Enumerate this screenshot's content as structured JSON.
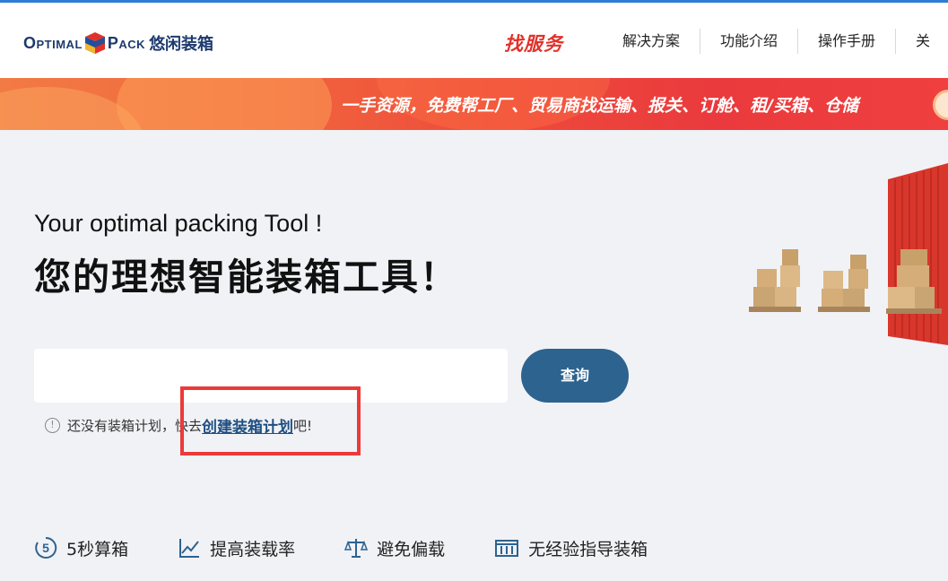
{
  "header": {
    "logo": {
      "text_left": "Optimal",
      "text_right": "Pack",
      "text_cn": "悠闲装箱"
    },
    "service_label": "找服务",
    "nav": [
      "解决方案",
      "功能介绍",
      "操作手册",
      "关"
    ]
  },
  "banner": {
    "text": "一手资源，免费帮工厂、贸易商找运输、报关、订舱、租/买箱、仓储"
  },
  "hero": {
    "title_en": "Your optimal packing Tool !",
    "title_cn": "您的理想智能装箱工具！"
  },
  "search": {
    "value": "",
    "placeholder": "",
    "button_label": "查询"
  },
  "hint": {
    "icon": "!",
    "prefix": "还没有装箱计划，快去",
    "link": "创建装箱计划",
    "suffix": "吧!"
  },
  "features": [
    {
      "icon": "five-seconds-icon",
      "label": "5秒算箱"
    },
    {
      "icon": "chart-line-icon",
      "label": "提高装载率"
    },
    {
      "icon": "balance-scale-icon",
      "label": "避免偏载"
    },
    {
      "icon": "container-guide-icon",
      "label": "无经验指导装箱"
    }
  ],
  "colors": {
    "accent": "#2d638f",
    "brand_red": "#e0322b",
    "highlight": "#ec3a3a"
  }
}
